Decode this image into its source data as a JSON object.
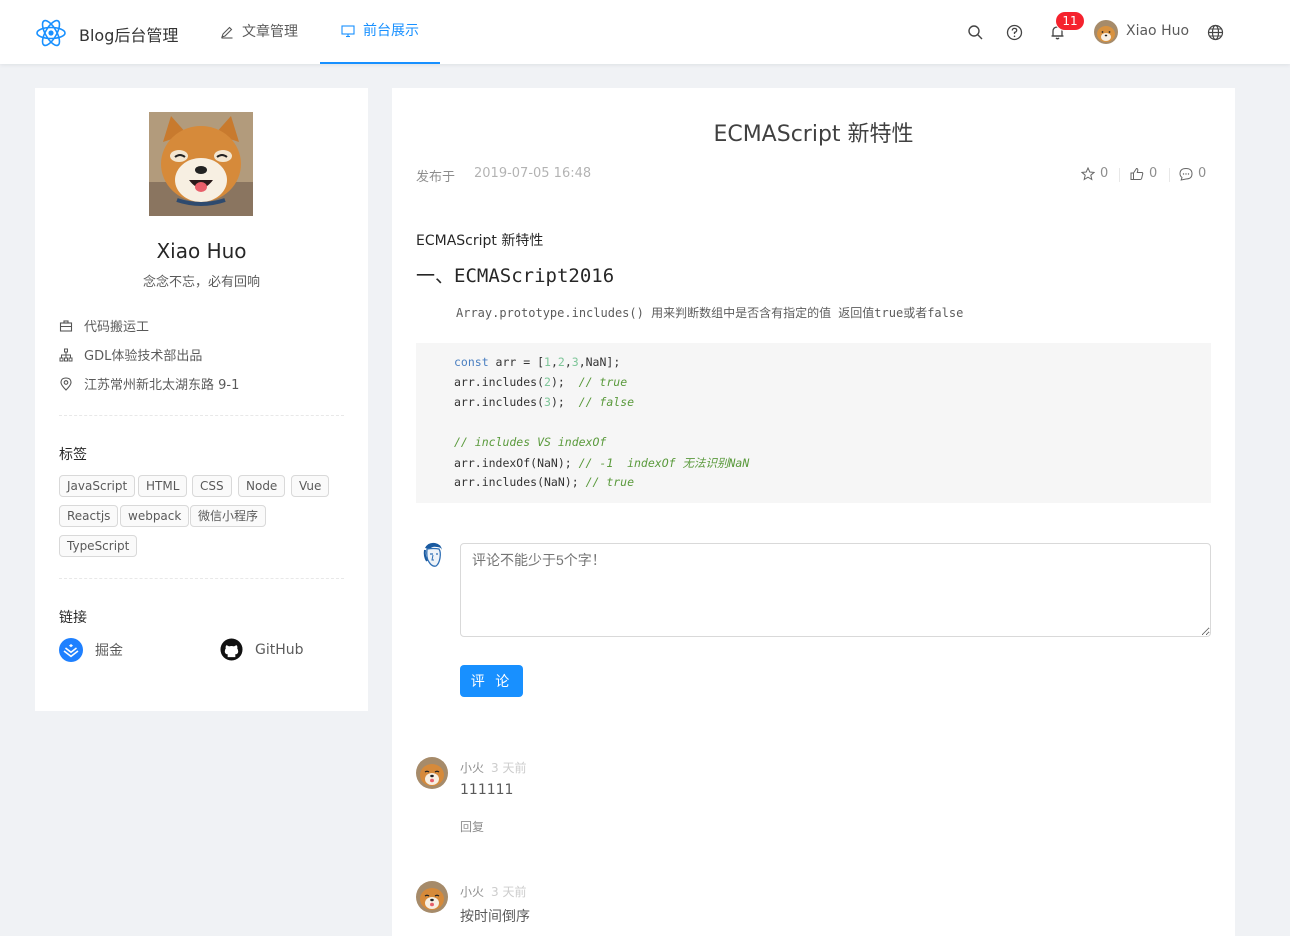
{
  "header": {
    "brand": "Blog后台管理",
    "nav": {
      "articles": "文章管理",
      "front": "前台展示"
    },
    "notification_count": "11",
    "user": "Xiao Huo",
    "icons": [
      "react-logo-icon",
      "edit-icon",
      "desktop-icon",
      "search-icon",
      "question-icon",
      "bell-icon",
      "globe-icon"
    ],
    "accent": "#1890ff",
    "badge_color": "#f5222d"
  },
  "profile": {
    "name": "Xiao Huo",
    "motto": "念念不忘，必有回响",
    "job": "代码搬运工",
    "team": "GDL体验技术部出品",
    "location": "江苏常州新北太湖东路 9-1",
    "tags_title": "标签",
    "tags": [
      "JavaScript",
      "HTML",
      "CSS",
      "Node",
      "Vue",
      "Reactjs",
      "webpack",
      "微信小程序",
      "TypeScript"
    ],
    "links_title": "链接",
    "links": {
      "juejin": "掘金",
      "github": "GitHub"
    }
  },
  "article": {
    "title": "ECMAScript 新特性",
    "published_label": "发布于",
    "published_at": "2019-07-05 16:48",
    "stars": "0",
    "likes": "0",
    "comments": "0",
    "subtitle": "ECMAScript 新特性",
    "heading": "一、ECMAScript2016",
    "description": "Array.prototype.includes() 用来判断数组中是否含有指定的值 返回值true或者false"
  },
  "comment_form": {
    "placeholder": "评论不能少于5个字！",
    "submit": "评 论"
  },
  "comments": [
    {
      "author": "小火",
      "time": "3 天前",
      "text": "111111",
      "reply": "回复"
    },
    {
      "author": "小火",
      "time": "3 天前",
      "text": "按时间倒序"
    }
  ]
}
